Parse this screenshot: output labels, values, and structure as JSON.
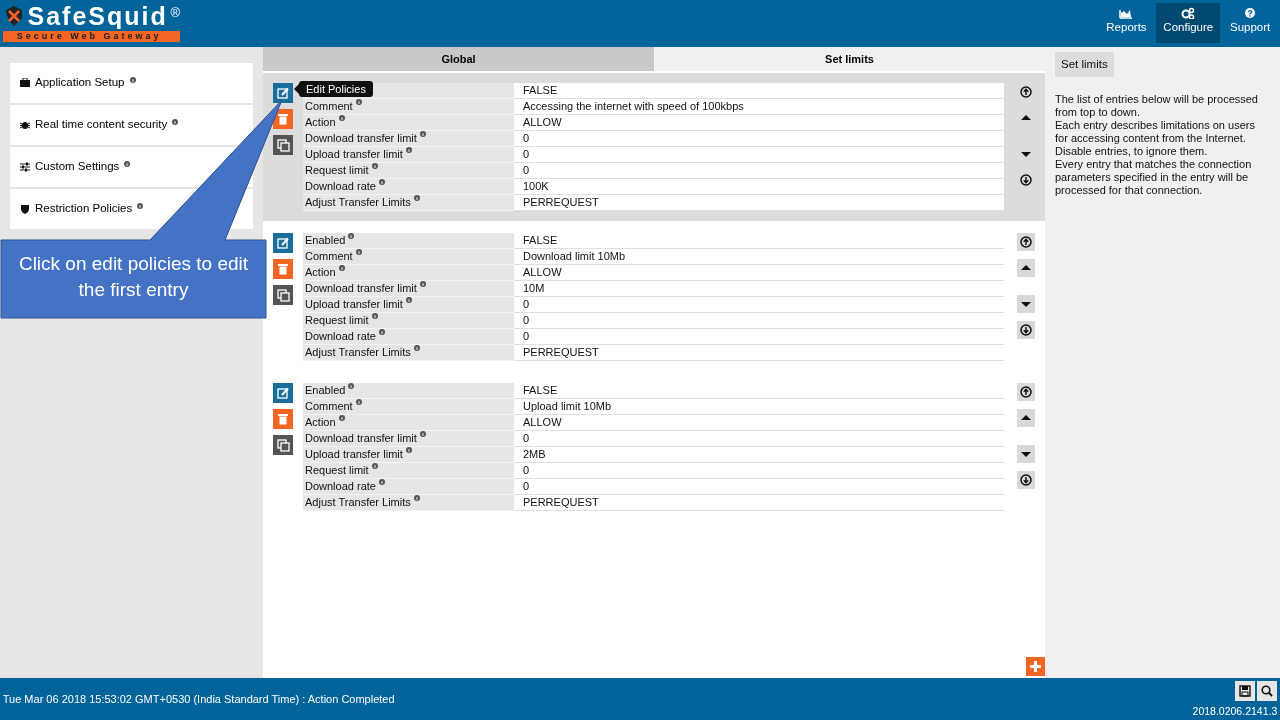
{
  "brand": {
    "name": "SafeSquid",
    "registered": "®",
    "tagline": "Secure Web Gateway"
  },
  "nav": [
    {
      "label": "Reports",
      "selected": false
    },
    {
      "label": "Configure",
      "selected": true
    },
    {
      "label": "Support",
      "selected": false
    }
  ],
  "sidebar": {
    "items": [
      {
        "label": "Application Setup"
      },
      {
        "label": "Real time content security"
      },
      {
        "label": "Custom Settings"
      },
      {
        "label": "Restriction Policies"
      }
    ]
  },
  "tabs": [
    {
      "label": "Global",
      "selected": false
    },
    {
      "label": "Set limits",
      "selected": true
    }
  ],
  "tooltip": "Edit Policies",
  "callout": "Click on edit policies to edit the first entry",
  "entries": [
    {
      "selected": true,
      "fields": [
        {
          "value": "FALSE"
        },
        {
          "label": "Comment",
          "value": "Accessing the internet with speed of 100kbps"
        },
        {
          "label": "Action",
          "value": "ALLOW"
        },
        {
          "label": "Download transfer limit",
          "value": "0"
        },
        {
          "label": "Upload transfer limit",
          "value": "0"
        },
        {
          "label": "Request limit",
          "value": "0"
        },
        {
          "label": "Download rate",
          "value": "100K"
        },
        {
          "label": "Adjust Transfer Limits",
          "value": "PERREQUEST"
        }
      ]
    },
    {
      "selected": false,
      "fields": [
        {
          "label": "Enabled",
          "value": "FALSE"
        },
        {
          "label": "Comment",
          "value": "Download limit 10Mb"
        },
        {
          "label": "Action",
          "value": "ALLOW"
        },
        {
          "label": "Download transfer limit",
          "value": "10M"
        },
        {
          "label": "Upload transfer limit",
          "value": "0"
        },
        {
          "label": "Request limit",
          "value": "0"
        },
        {
          "label": "Download rate",
          "value": "0"
        },
        {
          "label": "Adjust Transfer Limits",
          "value": "PERREQUEST"
        }
      ]
    },
    {
      "selected": false,
      "fields": [
        {
          "label": "Enabled",
          "value": "FALSE"
        },
        {
          "label": "Comment",
          "value": "Upload limit 10Mb"
        },
        {
          "label": "Action",
          "value": "ALLOW"
        },
        {
          "label": "Download transfer limit",
          "value": "0"
        },
        {
          "label": "Upload transfer limit",
          "value": "2MB"
        },
        {
          "label": "Request limit",
          "value": "0"
        },
        {
          "label": "Download rate",
          "value": "0"
        },
        {
          "label": "Adjust Transfer Limits",
          "value": "PERREQUEST"
        }
      ]
    }
  ],
  "help": {
    "title": "Set limits",
    "lines": [
      "The list of entries below will be processed from top to down.",
      "Each entry describes limitations on users for accessing content from the Internet.",
      "Disable entries, to ignore them.",
      "Every entry that matches the connection parameters specified in the entry will be processed for that connection."
    ]
  },
  "status_bar": {
    "message": "Tue Mar 06 2018 15:53:02 GMT+0530 (India Standard Time) : Action Completed",
    "version": "2018.0206.2141.3"
  }
}
